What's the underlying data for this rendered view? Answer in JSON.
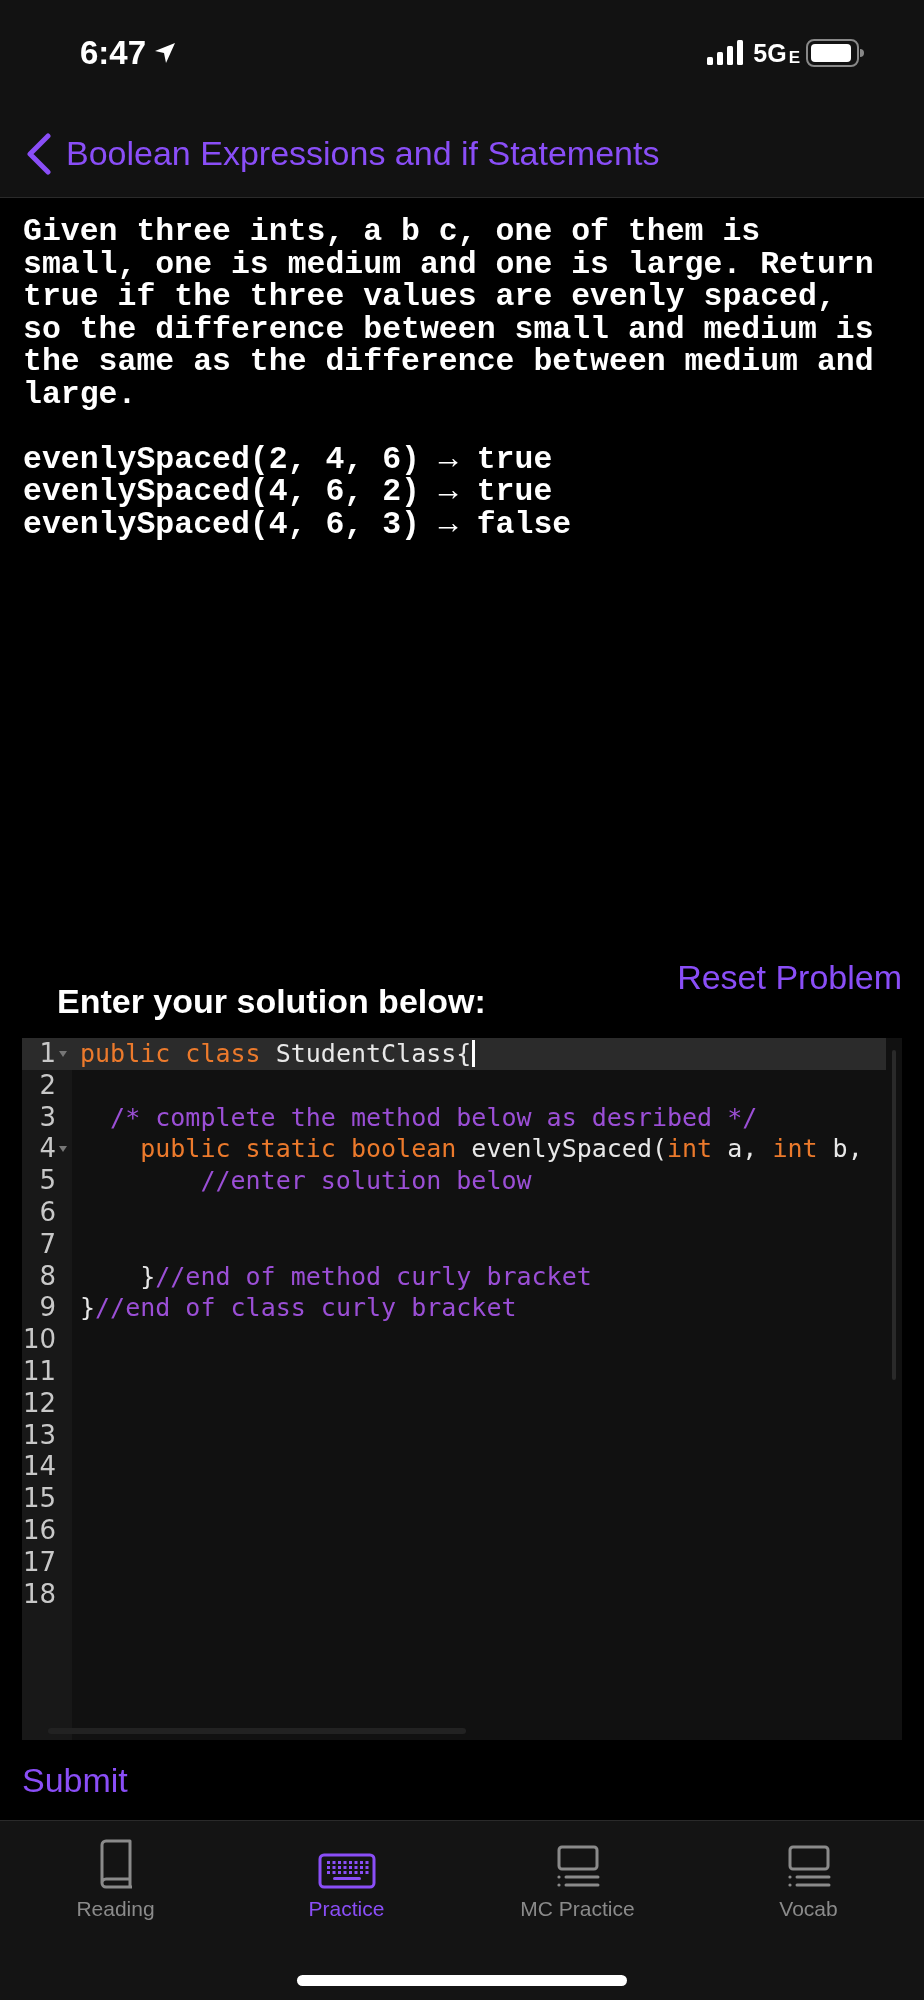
{
  "status_bar": {
    "time": "6:47",
    "network": "5G",
    "network_suffix": "E"
  },
  "header": {
    "title": "Boolean Expressions and if Statements"
  },
  "problem": {
    "description": "Given three ints, a b c, one of them is small, one is medium and one is large. Return true if the three values are evenly spaced, so the difference between small and medium is the same as the difference between medium and large.",
    "examples": [
      "evenlySpaced(2, 4, 6) → true",
      "evenlySpaced(4, 6, 2) → true",
      "evenlySpaced(4, 6, 3) → false"
    ]
  },
  "reset_button": "Reset Problem",
  "solution_label": "Enter your solution below:",
  "editor": {
    "lines": [
      {
        "number": "1",
        "foldable": true,
        "active": true,
        "tokens": [
          {
            "text": "public class ",
            "kind": "keyword"
          },
          {
            "text": "StudentClass{",
            "kind": "plain"
          }
        ]
      },
      {
        "number": "2",
        "foldable": false,
        "active": false
      },
      {
        "number": "3",
        "foldable": false,
        "active": false,
        "tokens": [
          {
            "text": "  /* complete the method below as desribed */",
            "kind": "comment"
          }
        ]
      },
      {
        "number": "4",
        "foldable": true,
        "active": false,
        "tokens": [
          {
            "text": "    public static boolean ",
            "kind": "keyword"
          },
          {
            "text": "evenlySpaced(",
            "kind": "plain"
          },
          {
            "text": "int",
            "kind": "keyword"
          },
          {
            "text": " a, ",
            "kind": "plain"
          },
          {
            "text": "int",
            "kind": "keyword"
          },
          {
            "text": " b,",
            "kind": "plain"
          }
        ]
      },
      {
        "number": "5",
        "foldable": false,
        "active": false,
        "tokens": [
          {
            "text": "        //enter solution below",
            "kind": "comment"
          }
        ]
      },
      {
        "number": "6",
        "foldable": false,
        "active": false
      },
      {
        "number": "7",
        "foldable": false,
        "active": false
      },
      {
        "number": "8",
        "foldable": false,
        "active": false,
        "tokens": [
          {
            "text": "    }",
            "kind": "plain"
          },
          {
            "text": "//end of method curly bracket",
            "kind": "comment"
          }
        ]
      },
      {
        "number": "9",
        "foldable": false,
        "active": false,
        "tokens": [
          {
            "text": "}",
            "kind": "plain"
          },
          {
            "text": "//end of class curly bracket",
            "kind": "comment"
          }
        ]
      },
      {
        "number": "10",
        "foldable": false,
        "active": false
      },
      {
        "number": "11",
        "foldable": false,
        "active": false
      },
      {
        "number": "12",
        "foldable": false,
        "active": false
      },
      {
        "number": "13",
        "foldable": false,
        "active": false
      },
      {
        "number": "14",
        "foldable": false,
        "active": false
      },
      {
        "number": "15",
        "foldable": false,
        "active": false
      },
      {
        "number": "16",
        "foldable": false,
        "active": false
      },
      {
        "number": "17",
        "foldable": false,
        "active": false
      },
      {
        "number": "18",
        "foldable": false,
        "active": false
      }
    ]
  },
  "submit_button": "Submit",
  "tabs": [
    {
      "label": "Reading",
      "kind": "book",
      "selected": false
    },
    {
      "label": "Practice",
      "kind": "keyboard",
      "selected": true
    },
    {
      "label": "MC Practice",
      "kind": "screen",
      "selected": false
    },
    {
      "label": "Vocab",
      "kind": "screen",
      "selected": false
    }
  ]
}
